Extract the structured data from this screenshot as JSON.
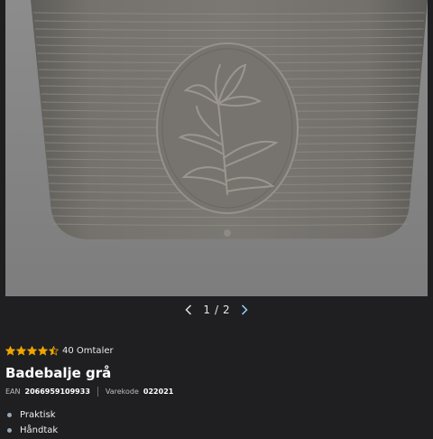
{
  "gallery": {
    "image_alt": "Badebalje grå",
    "current": "1",
    "separator": "/",
    "total": "2",
    "prev_icon": "chevron-left-icon",
    "next_icon": "chevron-right-icon"
  },
  "rating": {
    "score": 4.5,
    "max": 5,
    "reviews_text": "40 Omtaler",
    "star_color": "#f0a500"
  },
  "product": {
    "title": "Badebalje grå",
    "ean_label": "EAN",
    "ean_value": "2066959109933",
    "sku_label": "Varekode",
    "sku_value": "022021"
  },
  "features": [
    "Praktisk",
    "Håndtak"
  ]
}
